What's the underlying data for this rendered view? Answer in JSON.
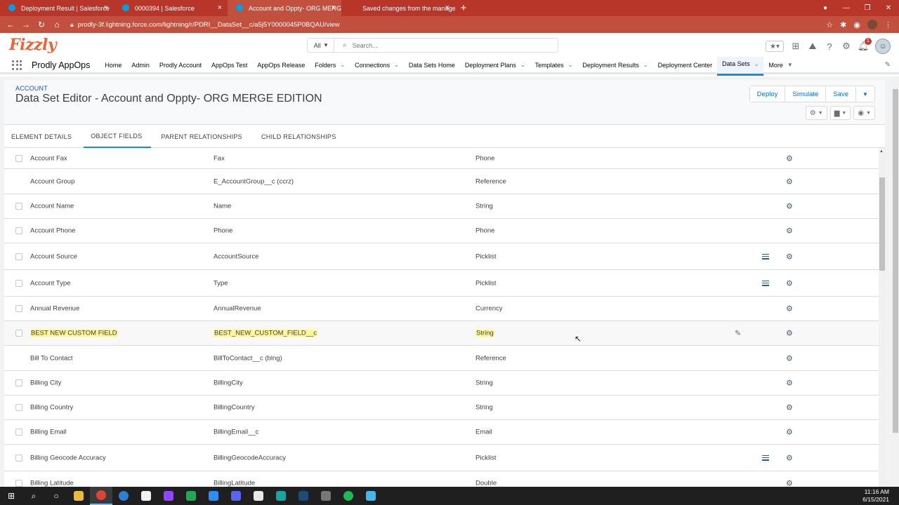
{
  "browser": {
    "tabs": [
      {
        "title": "Deployment Result | Salesforce",
        "active": false
      },
      {
        "title": "0000394 | Salesforce",
        "active": false
      },
      {
        "title": "Account and Oppty- ORG MERGE",
        "active": true
      },
      {
        "title": "Saved changes from the manage",
        "active": false
      }
    ],
    "url": "prodly-3f.lightning.force.com/lightning/r/PDRI__DataSet__c/a5j5Y0000045P0BQAU/view"
  },
  "header": {
    "logo": "Fizzly",
    "search_scope": "All",
    "search_placeholder": "Search...",
    "notification_count": "1"
  },
  "nav": {
    "app_name": "Prodly AppOps",
    "items": [
      {
        "label": "Home",
        "dropdown": false
      },
      {
        "label": "Admin",
        "dropdown": false
      },
      {
        "label": "Prodly Account",
        "dropdown": false
      },
      {
        "label": "AppOps Test",
        "dropdown": false
      },
      {
        "label": "AppOps Release",
        "dropdown": false
      },
      {
        "label": "Folders",
        "dropdown": true
      },
      {
        "label": "Connections",
        "dropdown": true
      },
      {
        "label": "Data Sets Home",
        "dropdown": false
      },
      {
        "label": "Deployment Plans",
        "dropdown": true
      },
      {
        "label": "Templates",
        "dropdown": true
      },
      {
        "label": "Deployment Results",
        "dropdown": true
      },
      {
        "label": "Deployment Center",
        "dropdown": false
      },
      {
        "label": "Data Sets",
        "dropdown": true,
        "active": true
      },
      {
        "label": "More",
        "dropdown": true
      }
    ]
  },
  "page": {
    "kicker": "ACCOUNT",
    "title": "Data Set Editor - Account and Oppty- ORG MERGE EDITION",
    "buttons": {
      "deploy": "Deploy",
      "simulate": "Simulate",
      "save": "Save"
    }
  },
  "tabs": [
    {
      "label": "ELEMENT DETAILS",
      "active": false
    },
    {
      "label": "OBJECT FIELDS",
      "active": true
    },
    {
      "label": "PARENT RELATIONSHIPS",
      "active": false
    },
    {
      "label": "CHILD RELATIONSHIPS",
      "active": false
    }
  ],
  "fields": [
    {
      "label": "Account Fax",
      "api": "Fax",
      "type": "Phone",
      "checkbox": true,
      "list": false
    },
    {
      "label": "Account Group",
      "api": "E_AccountGroup__c (ccrz)",
      "type": "Reference",
      "checkbox": false,
      "list": false
    },
    {
      "label": "Account Name",
      "api": "Name",
      "type": "String",
      "checkbox": true,
      "list": false
    },
    {
      "label": "Account Phone",
      "api": "Phone",
      "type": "Phone",
      "checkbox": true,
      "list": false
    },
    {
      "label": "Account Source",
      "api": "AccountSource",
      "type": "Picklist",
      "checkbox": true,
      "list": true
    },
    {
      "label": "Account Type",
      "api": "Type",
      "type": "Picklist",
      "checkbox": true,
      "list": true
    },
    {
      "label": "Annual Revenue",
      "api": "AnnualRevenue",
      "type": "Currency",
      "checkbox": true,
      "list": false
    },
    {
      "label": "BEST NEW CUSTOM FIELD",
      "api": "BEST_NEW_CUSTOM_FIELD__c",
      "type": "String",
      "checkbox": true,
      "list": false,
      "highlight": true
    },
    {
      "label": "Bill To Contact",
      "api": "BillToContact__c (blng)",
      "type": "Reference",
      "checkbox": false,
      "list": false
    },
    {
      "label": "Billing City",
      "api": "BillingCity",
      "type": "String",
      "checkbox": true,
      "list": false
    },
    {
      "label": "Billing Country",
      "api": "BillingCountry",
      "type": "String",
      "checkbox": true,
      "list": false
    },
    {
      "label": "Billing Email",
      "api": "BillingEmail__c",
      "type": "Email",
      "checkbox": true,
      "list": false
    },
    {
      "label": "Billing Geocode Accuracy",
      "api": "BillingGeocodeAccuracy",
      "type": "Picklist",
      "checkbox": true,
      "list": true
    },
    {
      "label": "Billing Latitude",
      "api": "BillingLatitude",
      "type": "Double",
      "checkbox": true,
      "list": false
    }
  ],
  "taskbar": {
    "time": "11:16 AM",
    "date": "6/15/2021"
  }
}
